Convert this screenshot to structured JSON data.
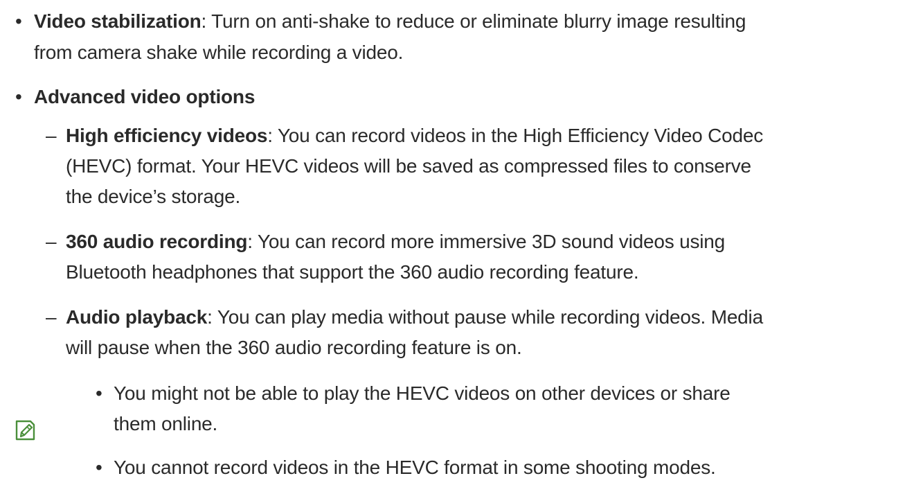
{
  "items": {
    "video_stabilization": {
      "term": "Video stabilization",
      "text_line1": ": Turn on anti-shake to reduce or eliminate blurry image resulting",
      "text_line2": "from camera shake while recording a video."
    },
    "advanced_video_options": {
      "term": "Advanced video options"
    },
    "high_efficiency": {
      "term": "High efficiency videos",
      "text_line1": ": You can record videos in the High Efficiency Video Codec",
      "text_line2": "(HEVC) format. Your HEVC videos will be saved as compressed files to conserve",
      "text_line3": "the device’s storage."
    },
    "audio_360": {
      "term": "360 audio recording",
      "text_line1": ": You can record more immersive 3D sound videos using",
      "text_line2": "Bluetooth headphones that support the 360 audio recording feature."
    },
    "audio_playback": {
      "term": "Audio playback",
      "text_line1": ": You can play media without pause while recording videos. Media",
      "text_line2": "will pause when the 360 audio recording feature is on."
    }
  },
  "notes": {
    "icon": "note-pencil-icon",
    "note1_line1": "You might not be able to play the HEVC videos on other devices or share",
    "note1_line2": "them online.",
    "note2": "You cannot record videos in the HEVC format in some shooting modes."
  },
  "symbols": {
    "bullet": "•",
    "dash": "–"
  },
  "colors": {
    "text": "#2a2a2a",
    "note_icon": "#4a8f3a"
  }
}
